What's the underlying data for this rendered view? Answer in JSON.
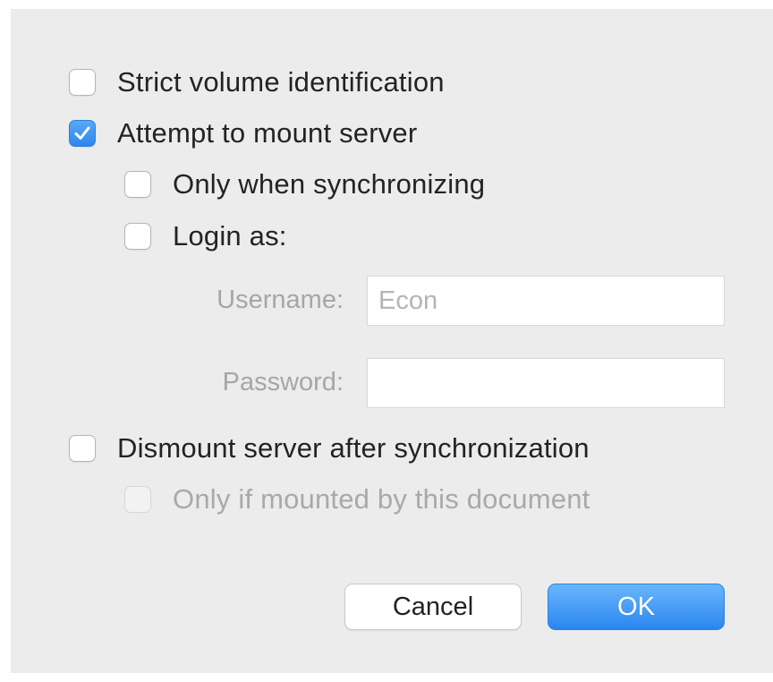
{
  "options": {
    "strict_volume": {
      "label": "Strict volume identification",
      "checked": false
    },
    "attempt_mount": {
      "label": "Attempt to mount server",
      "checked": true
    },
    "only_sync": {
      "label": "Only when synchronizing",
      "checked": false
    },
    "login_as": {
      "label": "Login as:",
      "checked": false
    },
    "dismount": {
      "label": "Dismount server after synchronization",
      "checked": false
    },
    "only_mounted": {
      "label": "Only if mounted by this document",
      "checked": false,
      "disabled": true
    }
  },
  "fields": {
    "username": {
      "label": "Username:",
      "value": "Econ"
    },
    "password": {
      "label": "Password:",
      "value": ""
    }
  },
  "buttons": {
    "cancel": "Cancel",
    "ok": "OK"
  },
  "colors": {
    "dialog_bg": "#ececec",
    "accent": "#2d86ee"
  },
  "icons": {
    "checked": "checkmark-icon"
  }
}
